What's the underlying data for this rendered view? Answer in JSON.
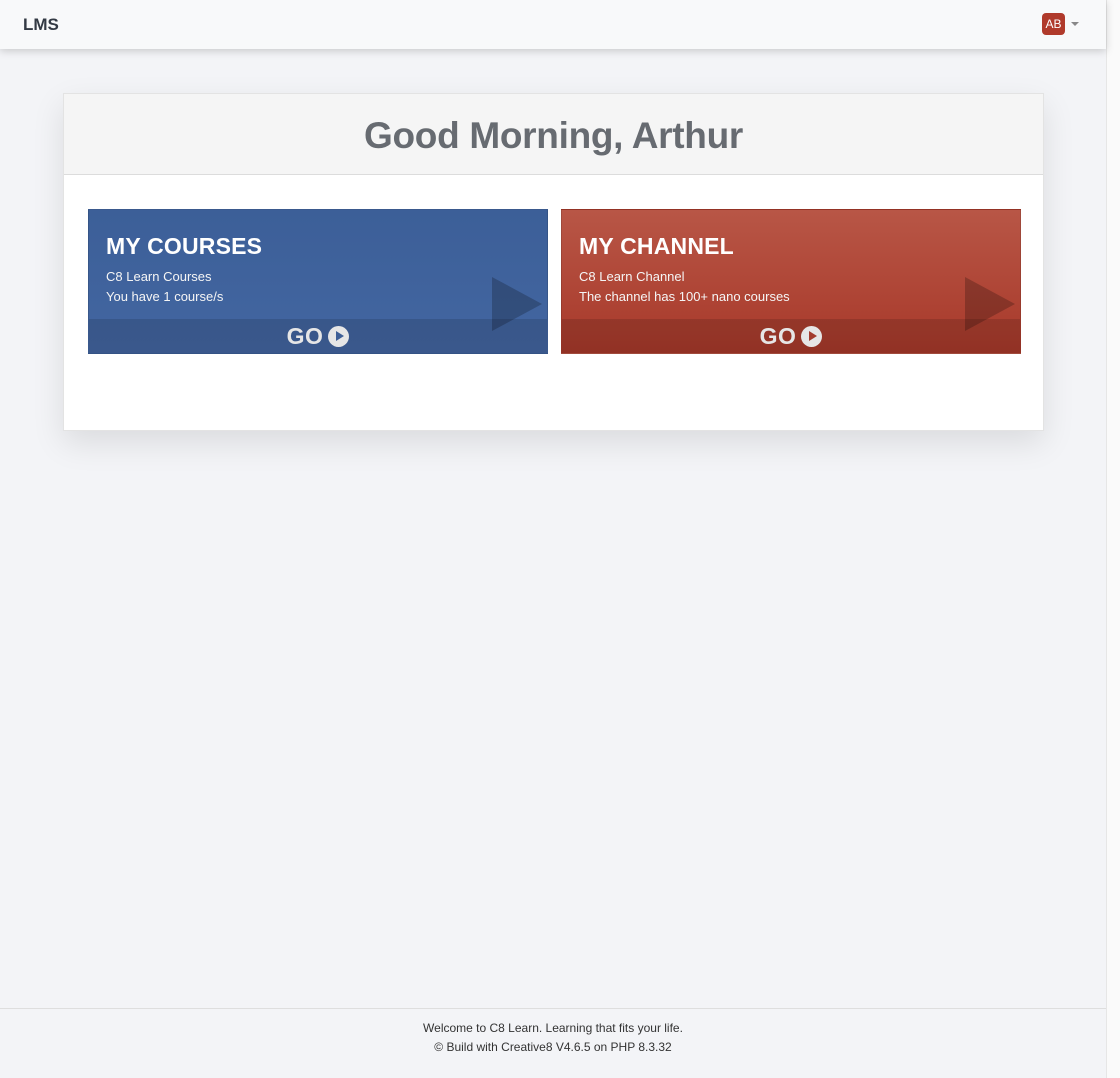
{
  "navbar": {
    "brand": "LMS",
    "user_initials": "AB",
    "avatar_color": "#b03a2b"
  },
  "main": {
    "greeting": "Good Morning, Arthur",
    "tiles": [
      {
        "title": "MY COURSES",
        "subtitle": "C8 Learn Courses",
        "description": "You have 1 course/s",
        "action_label": "GO",
        "color": "#3e619b",
        "icon": "play-icon"
      },
      {
        "title": "MY CHANNEL",
        "subtitle": "C8 Learn Channel",
        "description": "The channel has 100+ nano courses",
        "action_label": "GO",
        "color": "#b04636",
        "icon": "play-icon"
      }
    ]
  },
  "footer": {
    "line1": "Welcome to C8 Learn. Learning that fits your life.",
    "line2": "© Build with Creative8 V4.6.5 on PHP 8.3.32"
  }
}
